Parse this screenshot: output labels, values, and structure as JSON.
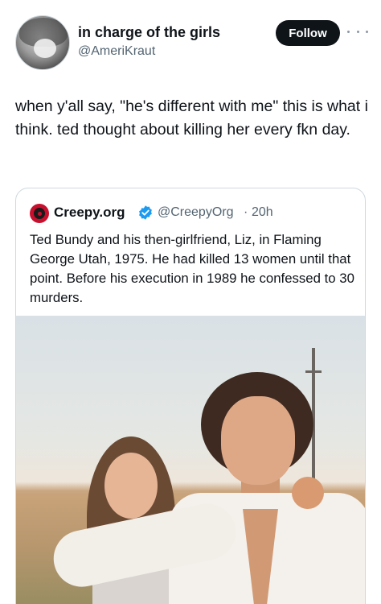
{
  "author": {
    "display_name": "in charge of the girls",
    "handle": "@AmeriKraut",
    "follow_label": "Follow"
  },
  "tweet": {
    "text": "when y'all say, \"he's different with me\" this is what i think. ted thought about killing her every fkn day."
  },
  "quoted": {
    "name": "Creepy.org",
    "handle": "@CreepyOrg",
    "separator": "·",
    "time": "20h",
    "text": "Ted Bundy and his then-girlfriend, Liz, in Flaming George Utah, 1975. He had killed 13 women until that point. Before his execution in 1989 he confessed to 30 murders.",
    "verified": true,
    "logo_color": "#c8102e",
    "verified_color": "#1d9bf0"
  },
  "icons": {
    "more": "more-horizontal-icon",
    "verified": "verified-badge-icon",
    "logo": "creepy-logo-icon"
  },
  "colors": {
    "follow_button_bg": "#0f1419",
    "secondary_text": "#536471",
    "border": "#cfd9de"
  }
}
